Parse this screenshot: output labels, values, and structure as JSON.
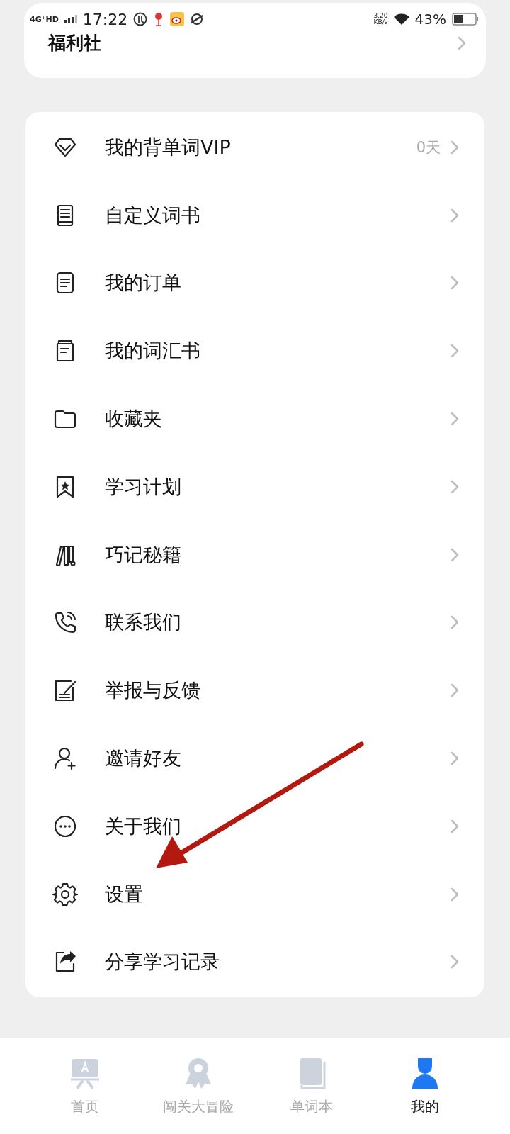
{
  "status_bar": {
    "network": "4G⁺HD",
    "time": "17:22",
    "speed_value": "3.20",
    "speed_unit": "KB/s",
    "battery": "43%"
  },
  "welfare_card": {
    "title": "福利社"
  },
  "menu": [
    {
      "label": "我的背单词VIP",
      "value": "0天"
    },
    {
      "label": "自定义词书"
    },
    {
      "label": "我的订单"
    },
    {
      "label": "我的词汇书"
    },
    {
      "label": "收藏夹"
    },
    {
      "label": "学习计划"
    },
    {
      "label": "巧记秘籍"
    },
    {
      "label": "联系我们"
    },
    {
      "label": "举报与反馈"
    },
    {
      "label": "邀请好友"
    },
    {
      "label": "关于我们"
    },
    {
      "label": "设置"
    },
    {
      "label": "分享学习记录"
    }
  ],
  "tab_bar": [
    {
      "label": "首页",
      "selected": false
    },
    {
      "label": "闯关大冒险",
      "selected": false
    },
    {
      "label": "单词本",
      "selected": false
    },
    {
      "label": "我的",
      "selected": true
    }
  ]
}
